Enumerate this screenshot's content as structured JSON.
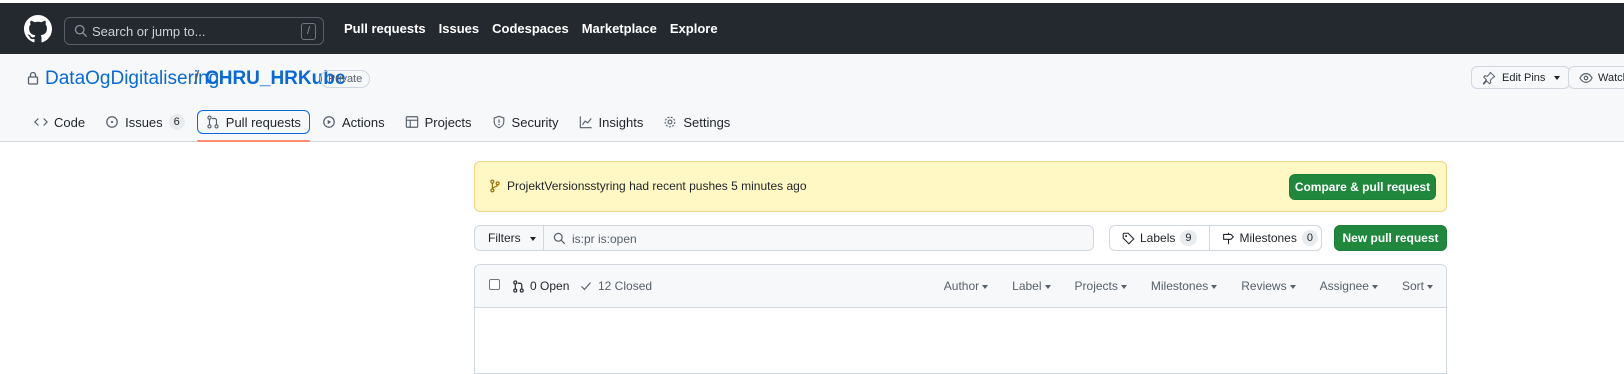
{
  "header": {
    "search_placeholder": "Search or jump to...",
    "search_shortcut": "/",
    "nav": [
      "Pull requests",
      "Issues",
      "Codespaces",
      "Marketplace",
      "Explore"
    ]
  },
  "repo": {
    "owner": "DataOgDigitalisering",
    "separator": "/",
    "name": "CHRU_HRKube",
    "visibility": "Private",
    "edit_pins_label": "Edit Pins",
    "watch_label": "Watch"
  },
  "tabs": [
    {
      "label": "Code",
      "icon": "code-icon"
    },
    {
      "label": "Issues",
      "icon": "issue-icon",
      "count": "6"
    },
    {
      "label": "Pull requests",
      "icon": "pull-request-icon",
      "active": true
    },
    {
      "label": "Actions",
      "icon": "play-icon"
    },
    {
      "label": "Projects",
      "icon": "table-icon"
    },
    {
      "label": "Security",
      "icon": "shield-icon"
    },
    {
      "label": "Insights",
      "icon": "graph-icon"
    },
    {
      "label": "Settings",
      "icon": "gear-icon"
    }
  ],
  "banner": {
    "branch": "ProjektVersionsstyring",
    "message": "had recent pushes 5 minutes ago",
    "button": "Compare & pull request"
  },
  "filterbar": {
    "filters_label": "Filters",
    "query": "is:pr is:open",
    "labels_label": "Labels",
    "labels_count": "9",
    "milestones_label": "Milestones",
    "milestones_count": "0",
    "new_pr_label": "New pull request"
  },
  "list": {
    "open_label": "0 Open",
    "closed_label": "12 Closed",
    "sort_menus": [
      "Author",
      "Label",
      "Projects",
      "Milestones",
      "Reviews",
      "Assignee",
      "Sort"
    ]
  },
  "colors": {
    "header_bg": "#24292f",
    "link": "#0969da",
    "primary_button": "#1f883d",
    "banner_bg": "#fff8c5",
    "active_underline": "#fd8c73"
  }
}
